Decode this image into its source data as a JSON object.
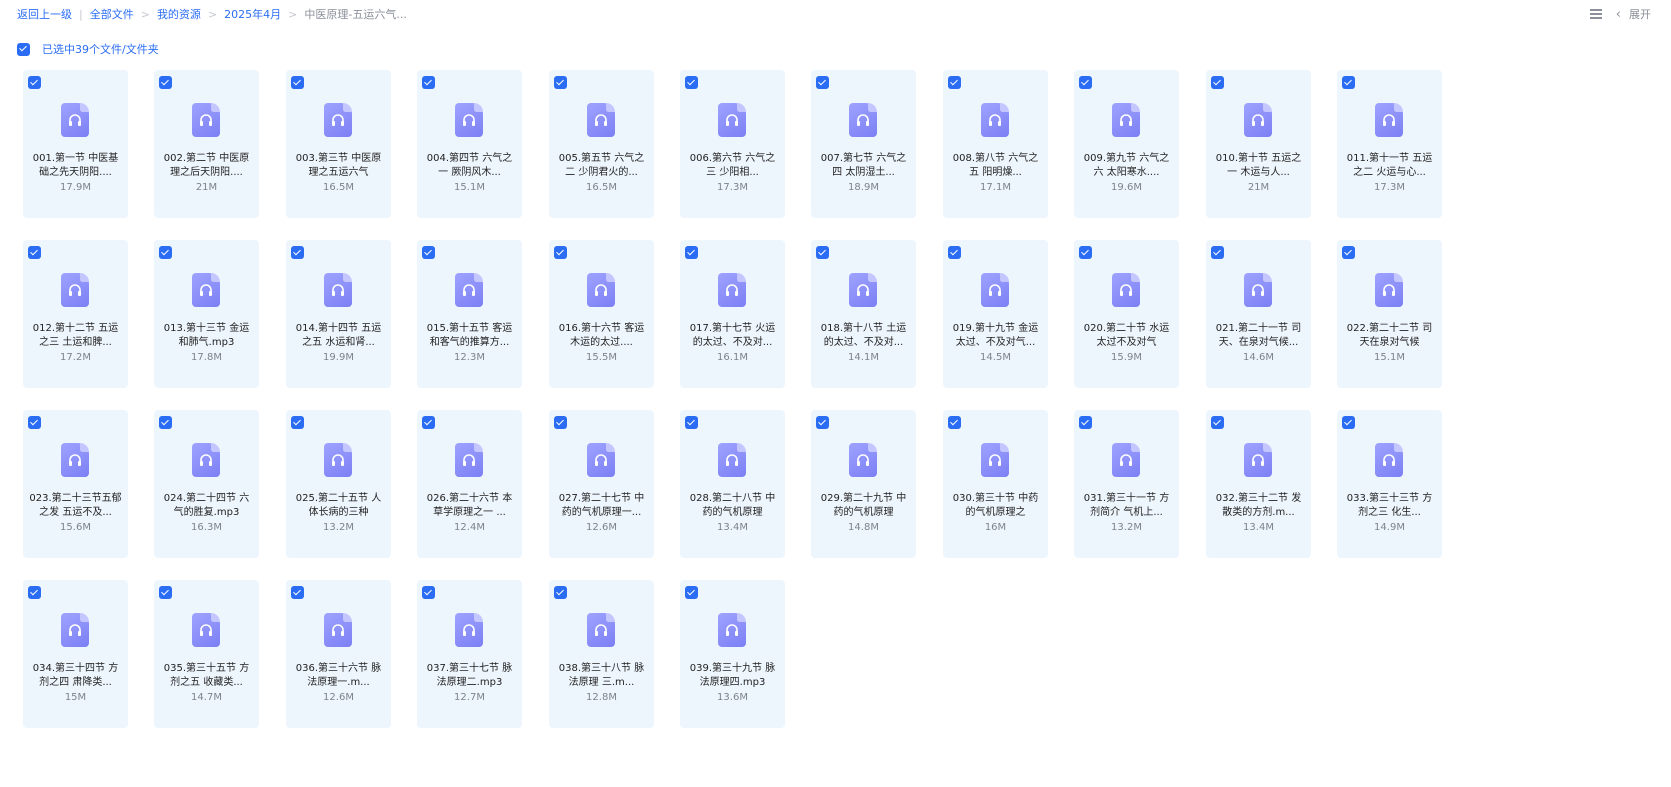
{
  "breadcrumb": {
    "back": "返回上一级",
    "items": [
      "全部文件",
      "我的资源",
      "2025年4月"
    ],
    "current": "中医原理-五运六气..."
  },
  "toolbar": {
    "list_view_icon": "list-view-icon",
    "collapse_icon": "chevron-left-icon",
    "expand_label": "展开"
  },
  "selection": {
    "label": "已选中39个文件/文件夹",
    "checked": true
  },
  "files": [
    {
      "name": "001.第一节 中医基础之先天阴阳....",
      "size": "17.9M"
    },
    {
      "name": "002.第二节 中医原理之后天阴阳....",
      "size": "21M"
    },
    {
      "name": "003.第三节 中医原理之五运六气",
      "size": "16.5M"
    },
    {
      "name": "004.第四节 六气之一 厥阴风木...",
      "size": "15.1M"
    },
    {
      "name": "005.第五节 六气之二 少阴君火的...",
      "size": "16.5M"
    },
    {
      "name": "006.第六节 六气之三 少阳相...",
      "size": "17.3M"
    },
    {
      "name": "007.第七节 六气之四 太阴湿土...",
      "size": "18.9M"
    },
    {
      "name": "008.第八节 六气之五 阳明燥...",
      "size": "17.1M"
    },
    {
      "name": "009.第九节 六气之六 太阳寒水....",
      "size": "19.6M"
    },
    {
      "name": "010.第十节 五运之一 木运与人...",
      "size": "21M"
    },
    {
      "name": "011.第十一节 五运之二 火运与心...",
      "size": "17.3M"
    },
    {
      "name": "012.第十二节 五运之三 土运和脾...",
      "size": "17.2M"
    },
    {
      "name": "013.第十三节 金运和肺气.mp3",
      "size": "17.8M"
    },
    {
      "name": "014.第十四节 五运之五 水运和肾...",
      "size": "19.9M"
    },
    {
      "name": "015.第十五节 客运和客气的推算方...",
      "size": "12.3M"
    },
    {
      "name": "016.第十六节 客运 木运的太过....",
      "size": "15.5M"
    },
    {
      "name": "017.第十七节 火运的太过、不及对...",
      "size": "16.1M"
    },
    {
      "name": "018.第十八节 土运的太过、不及对...",
      "size": "14.1M"
    },
    {
      "name": "019.第十九节 金运太过、不及对气...",
      "size": "14.5M"
    },
    {
      "name": "020.第二十节 水运太过不及对气",
      "size": "15.9M"
    },
    {
      "name": "021.第二十一节 司天、在泉对气候...",
      "size": "14.6M"
    },
    {
      "name": "022.第二十二节 司天在泉对气候",
      "size": "15.1M"
    },
    {
      "name": "023.第二十三节五郁之发 五运不及...",
      "size": "15.6M"
    },
    {
      "name": "024.第二十四节 六气的胜复.mp3",
      "size": "16.3M"
    },
    {
      "name": "025.第二十五节 人体长病的三种",
      "size": "13.2M"
    },
    {
      "name": "026.第二十六节 本草学原理之一 ...",
      "size": "12.4M"
    },
    {
      "name": "027.第二十七节 中药的气机原理一...",
      "size": "12.6M"
    },
    {
      "name": "028.第二十八节 中药的气机原理",
      "size": "13.4M"
    },
    {
      "name": "029.第二十九节 中药的气机原理",
      "size": "14.8M"
    },
    {
      "name": "030.第三十节 中药的气机原理之",
      "size": "16M"
    },
    {
      "name": "031.第三十一节 方剂简介 气机上...",
      "size": "13.2M"
    },
    {
      "name": "032.第三十二节 发散类的方剂.m...",
      "size": "13.4M"
    },
    {
      "name": "033.第三十三节 方剂之三 化生...",
      "size": "14.9M"
    },
    {
      "name": "034.第三十四节 方剂之四 肃降类...",
      "size": "15M"
    },
    {
      "name": "035.第三十五节 方剂之五 收藏类...",
      "size": "14.7M"
    },
    {
      "name": "036.第三十六节 脉法原理一.m...",
      "size": "12.6M"
    },
    {
      "name": "037.第三十七节 脉法原理二.mp3",
      "size": "12.7M"
    },
    {
      "name": "038.第三十八节 脉法原理 三.m...",
      "size": "12.8M"
    },
    {
      "name": "039.第三十九节 脉法原理四.mp3",
      "size": "13.6M"
    }
  ],
  "theme": {
    "accent": "#2a6df4",
    "card_bg": "#eef6fd",
    "icon_color": "#8b8ef8",
    "file_icon": "audio-file-icon",
    "checkbox_icon": "checkbox-checked-icon"
  }
}
